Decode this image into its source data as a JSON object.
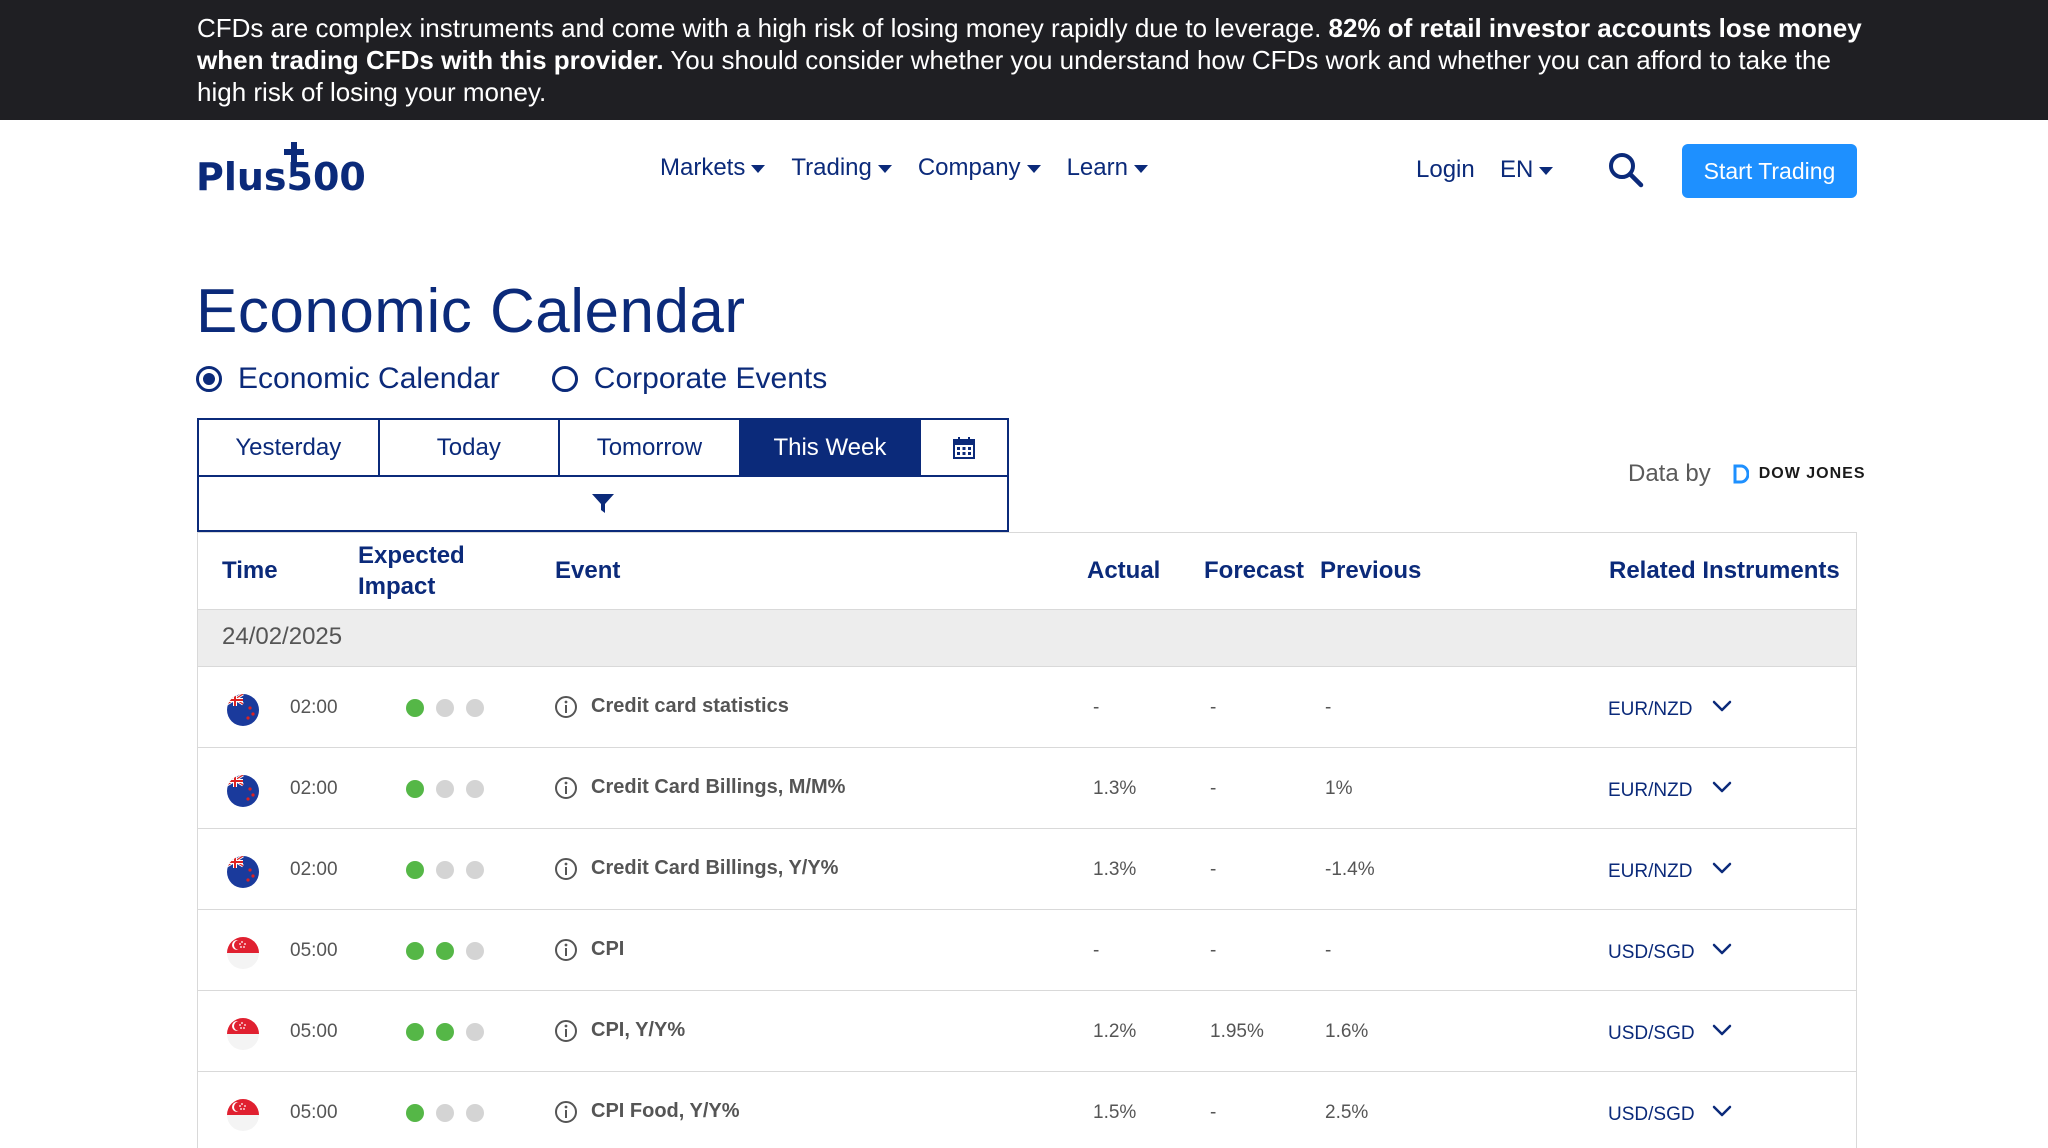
{
  "banner": {
    "text_pre": "CFDs are complex instruments and come with a high risk of losing money rapidly due to leverage. ",
    "text_bold": "82% of retail investor accounts lose money when trading CFDs with this provider.",
    "text_post": " You should consider whether you understand how CFDs work and whether you can afford to take the high risk of losing your money."
  },
  "header": {
    "logo": "Plus500",
    "nav": [
      "Markets",
      "Trading",
      "Company",
      "Learn"
    ],
    "login": "Login",
    "lang": "EN",
    "start_trading": "Start Trading"
  },
  "page": {
    "title": "Economic Calendar",
    "radios": [
      {
        "label": "Economic Calendar",
        "checked": true
      },
      {
        "label": "Corporate Events",
        "checked": false
      }
    ],
    "tabs": [
      "Yesterday",
      "Today",
      "Tomorrow",
      "This Week"
    ],
    "active_tab": "This Week",
    "data_by": "Data by",
    "data_source": "DOW JONES"
  },
  "table": {
    "headers": {
      "time": "Time",
      "impact_line1": "Expected",
      "impact_line2": "Impact",
      "event": "Event",
      "actual": "Actual",
      "forecast": "Forecast",
      "previous": "Previous",
      "related": "Related Instruments"
    },
    "date": "24/02/2025",
    "rows": [
      {
        "flag": "nz",
        "time": "02:00",
        "impact": 1,
        "event": "Credit card statistics",
        "actual": "-",
        "forecast": "-",
        "previous": "-",
        "instrument": "EUR/NZD"
      },
      {
        "flag": "nz",
        "time": "02:00",
        "impact": 1,
        "event": "Credit Card Billings, M/M%",
        "actual": "1.3%",
        "forecast": "-",
        "previous": "1%",
        "instrument": "EUR/NZD"
      },
      {
        "flag": "nz",
        "time": "02:00",
        "impact": 1,
        "event": "Credit Card Billings, Y/Y%",
        "actual": "1.3%",
        "forecast": "-",
        "previous": "-1.4%",
        "instrument": "EUR/NZD"
      },
      {
        "flag": "sg",
        "time": "05:00",
        "impact": 2,
        "event": "CPI",
        "actual": "-",
        "forecast": "-",
        "previous": "-",
        "instrument": "USD/SGD"
      },
      {
        "flag": "sg",
        "time": "05:00",
        "impact": 2,
        "event": "CPI, Y/Y%",
        "actual": "1.2%",
        "forecast": "1.95%",
        "previous": "1.6%",
        "instrument": "USD/SGD"
      },
      {
        "flag": "sg",
        "time": "05:00",
        "impact": 1,
        "event": "CPI Food, Y/Y%",
        "actual": "1.5%",
        "forecast": "-",
        "previous": "2.5%",
        "instrument": "USD/SGD"
      }
    ]
  },
  "colors": {
    "navy": "#0b2a7a",
    "accent": "#1e90ff",
    "impact_on": "#55b747",
    "impact_off": "#d4d4d4"
  }
}
